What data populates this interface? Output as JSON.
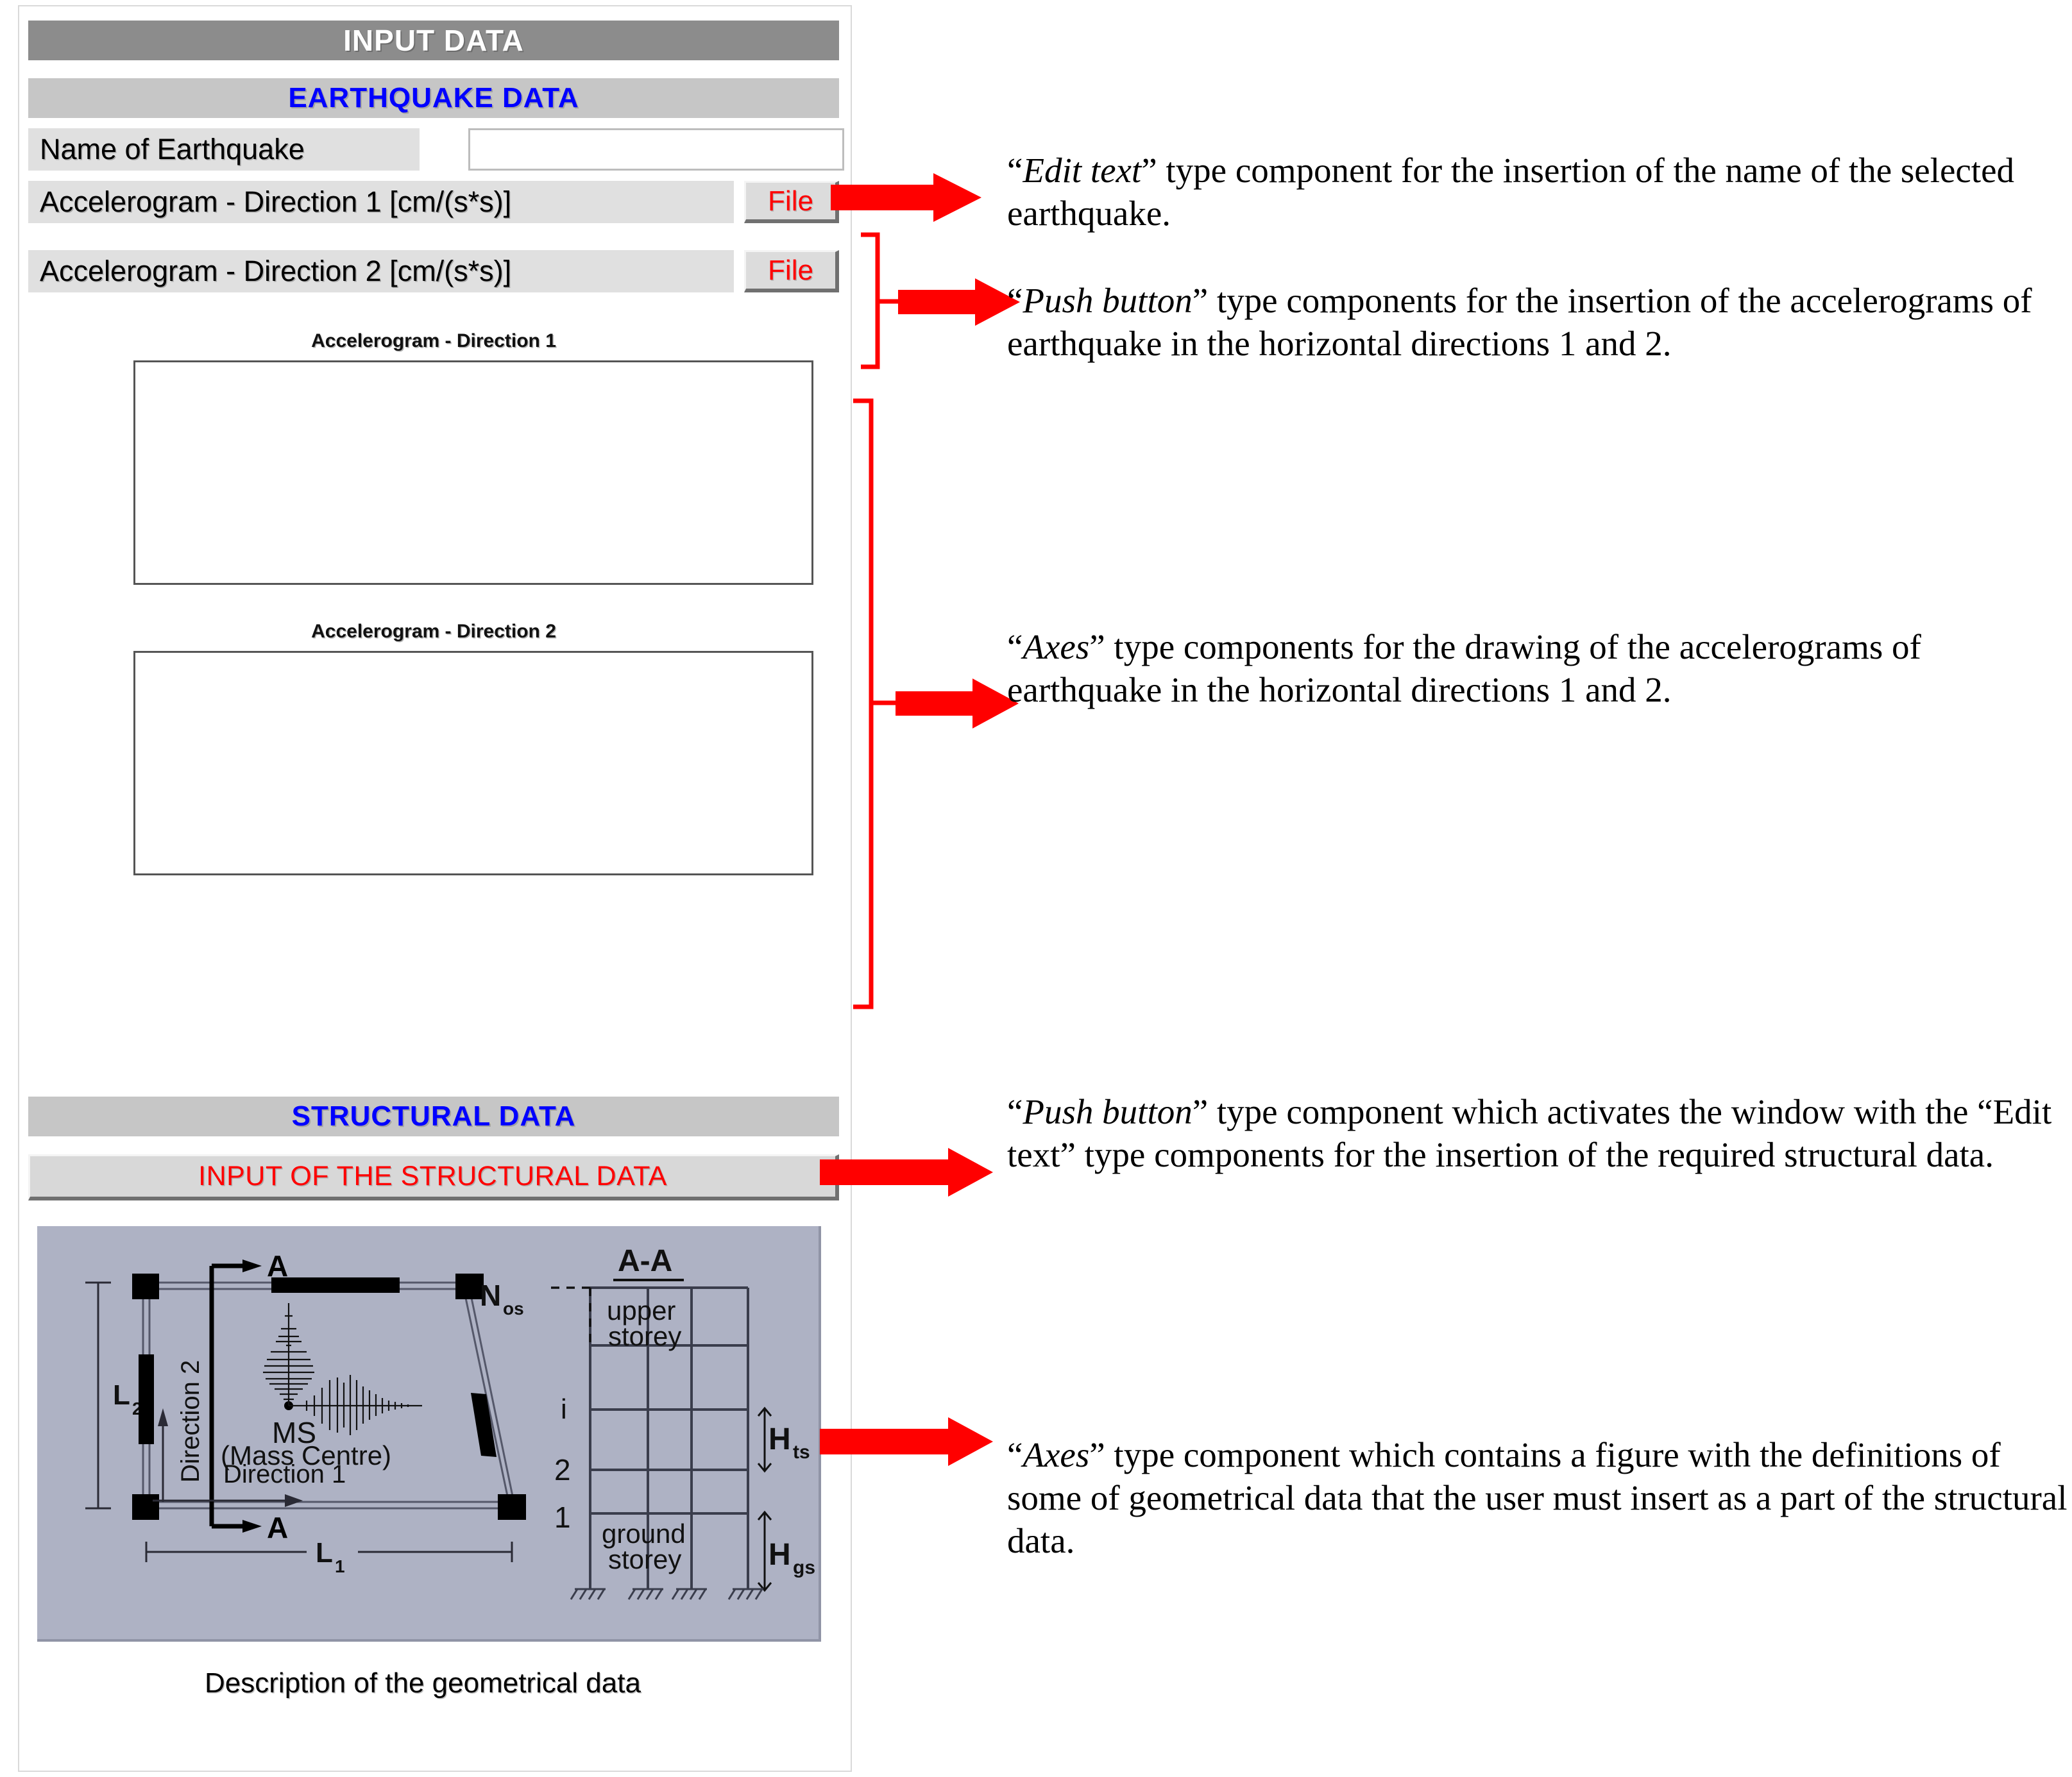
{
  "panel": {
    "title": "INPUT DATA",
    "earthquake_section_title": "EARTHQUAKE DATA",
    "structural_section_title": "STRUCTURAL DATA",
    "name_label": "Name of Earthquake",
    "name_value": "",
    "name_placeholder": "",
    "accelerogram_1_label": "Accelerogram - Direction 1 [cm/(s*s)]",
    "accelerogram_2_label": "Accelerogram - Direction 2 [cm/(s*s)]",
    "file_button_1": "File",
    "file_button_2": "File",
    "axes_1_title": "Accelerogram - Direction 1",
    "axes_2_title": "Accelerogram - Direction 2",
    "structural_button": "INPUT OF THE STRUCTURAL DATA",
    "figure_caption": "Description of the geometrical data"
  },
  "figure": {
    "section_label": "A-A",
    "marker_top": "A",
    "marker_bottom": "A",
    "dim_l1": "L",
    "dim_l1_sub": "1",
    "dim_l2": "L",
    "dim_l2_sub": "2",
    "direction_1": "Direction 1",
    "direction_2": "Direction 2",
    "mass_centre_abbr": "MS",
    "mass_centre_full": "(Mass Centre)",
    "nos_label": "N",
    "nos_sub": "os",
    "storey_i": "i",
    "storey_2": "2",
    "storey_1": "1",
    "upper_storey_line1": "upper",
    "upper_storey_line2": "storey",
    "ground_storey_line1": "ground",
    "ground_storey_line2": "storey",
    "h_ts": "H",
    "h_ts_sub": "ts",
    "h_gs": "H",
    "h_gs_sub": "gs"
  },
  "annotations": {
    "a1_quoted": "Edit text",
    "a1_rest": "” type component for the insertion of the name of the selected earthquake.",
    "a2_quoted": "Push button",
    "a2_rest": "” type components for the insertion of the accelerograms of earthquake in the horizontal directions 1 and 2.",
    "a3_quoted": "Axes",
    "a3_rest": "” type components for the drawing of the accelerograms of earthquake in the horizontal directions 1 and 2.",
    "a4_quoted": "Push button",
    "a4_rest": "” type component which activates the window with the “Edit text” type components for the insertion of the required structural data.",
    "a5_quoted": "Axes",
    "a5_rest": "” type component which contains a figure with the definitions of some of geometrical data that the user must insert as a part of the structural data.",
    "open_quote": "“"
  },
  "colors": {
    "accent_red": "#ff0000",
    "header_blue": "#0000ff",
    "title_bar_gray": "#8c8c8c",
    "section_bar_gray": "#c6c6c6",
    "figure_bg": "#aeb2c4"
  }
}
